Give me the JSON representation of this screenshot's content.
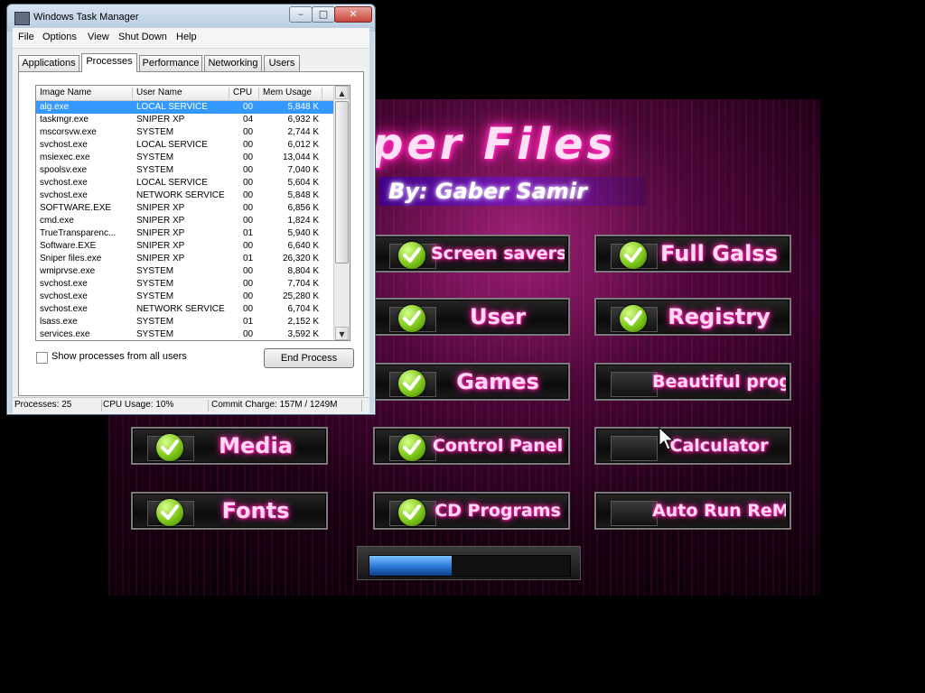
{
  "app": {
    "title": "per Files",
    "byline": "By: Gaber Samir",
    "options": [
      {
        "label": "Screen savers",
        "checked": true
      },
      {
        "label": "Full Galss",
        "checked": true
      },
      {
        "label": "User",
        "checked": true
      },
      {
        "label": "Registry",
        "checked": true
      },
      {
        "label": "Games",
        "checked": true
      },
      {
        "label": "Beautiful prog",
        "checked": false
      },
      {
        "label": "Media",
        "checked": true
      },
      {
        "label": "Control Panel",
        "checked": true
      },
      {
        "label": "Calculator",
        "checked": false
      },
      {
        "label": "Fonts",
        "checked": true
      },
      {
        "label": "CD Programs",
        "checked": true
      },
      {
        "label": "Auto Run ReM",
        "checked": false
      }
    ],
    "progress": 0.41
  },
  "taskmanager": {
    "title": "Windows Task Manager",
    "menu": [
      "File",
      "Options",
      "View",
      "Shut Down",
      "Help"
    ],
    "tabs": [
      "Applications",
      "Processes",
      "Performance",
      "Networking",
      "Users"
    ],
    "active_tab": "Processes",
    "columns": [
      "Image Name",
      "User Name",
      "CPU",
      "Mem Usage"
    ],
    "rows": [
      [
        "alg.exe",
        "LOCAL SERVICE",
        "00",
        "5,848 K"
      ],
      [
        "taskmgr.exe",
        "SNIPER XP",
        "04",
        "6,932 K"
      ],
      [
        "mscorsvw.exe",
        "SYSTEM",
        "00",
        "2,744 K"
      ],
      [
        "svchost.exe",
        "LOCAL SERVICE",
        "00",
        "6,012 K"
      ],
      [
        "msiexec.exe",
        "SYSTEM",
        "00",
        "13,044 K"
      ],
      [
        "spoolsv.exe",
        "SYSTEM",
        "00",
        "7,040 K"
      ],
      [
        "svchost.exe",
        "LOCAL SERVICE",
        "00",
        "5,604 K"
      ],
      [
        "svchost.exe",
        "NETWORK SERVICE",
        "00",
        "5,848 K"
      ],
      [
        "SOFTWARE.EXE",
        "SNIPER XP",
        "00",
        "6,856 K"
      ],
      [
        "cmd.exe",
        "SNIPER XP",
        "00",
        "1,824 K"
      ],
      [
        "TrueTransparenc...",
        "SNIPER XP",
        "01",
        "5,940 K"
      ],
      [
        "Software.EXE",
        "SNIPER XP",
        "00",
        "6,640 K"
      ],
      [
        "Sniper files.exe",
        "SNIPER XP",
        "01",
        "26,320 K"
      ],
      [
        "wmiprvse.exe",
        "SYSTEM",
        "00",
        "8,804 K"
      ],
      [
        "svchost.exe",
        "SYSTEM",
        "00",
        "7,704 K"
      ],
      [
        "svchost.exe",
        "SYSTEM",
        "00",
        "25,280 K"
      ],
      [
        "svchost.exe",
        "NETWORK SERVICE",
        "00",
        "6,704 K"
      ],
      [
        "lsass.exe",
        "SYSTEM",
        "01",
        "2,152 K"
      ],
      [
        "services.exe",
        "SYSTEM",
        "00",
        "3,592 K"
      ]
    ],
    "show_all_label": "Show processes from all users",
    "end_process_label": "End Process",
    "status": {
      "processes": "Processes: 25",
      "cpu": "CPU Usage: 10%",
      "commit": "Commit Charge: 157M / 1249M"
    }
  }
}
